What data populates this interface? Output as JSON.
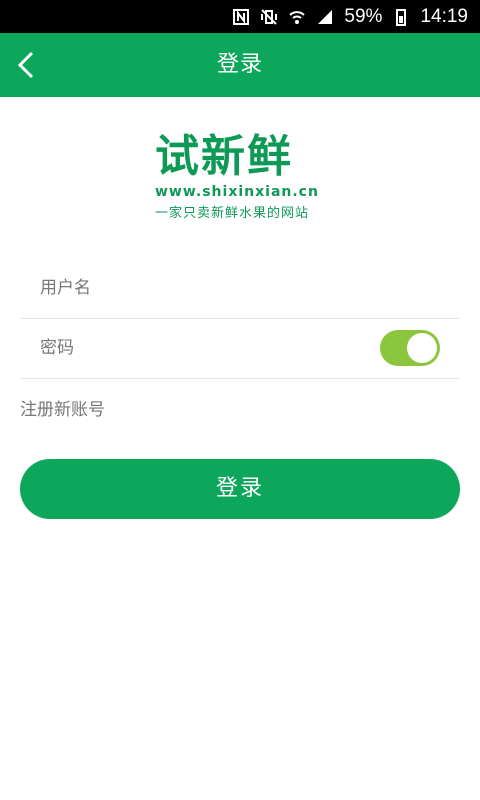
{
  "status_bar": {
    "battery": "59%",
    "time": "14:19"
  },
  "header": {
    "title": "登录"
  },
  "logo": {
    "main": "试新鲜",
    "url": "www.shixinxian.cn",
    "tagline": "一家只卖新鲜水果的网站"
  },
  "form": {
    "username_placeholder": "用户名",
    "password_placeholder": "密码",
    "password_toggle_on": true,
    "register_link": "注册新账号",
    "login_button": "登录"
  },
  "colors": {
    "primary": "#0DA75C",
    "toggle": "#8CC63E",
    "logo": "#0E9A56"
  }
}
